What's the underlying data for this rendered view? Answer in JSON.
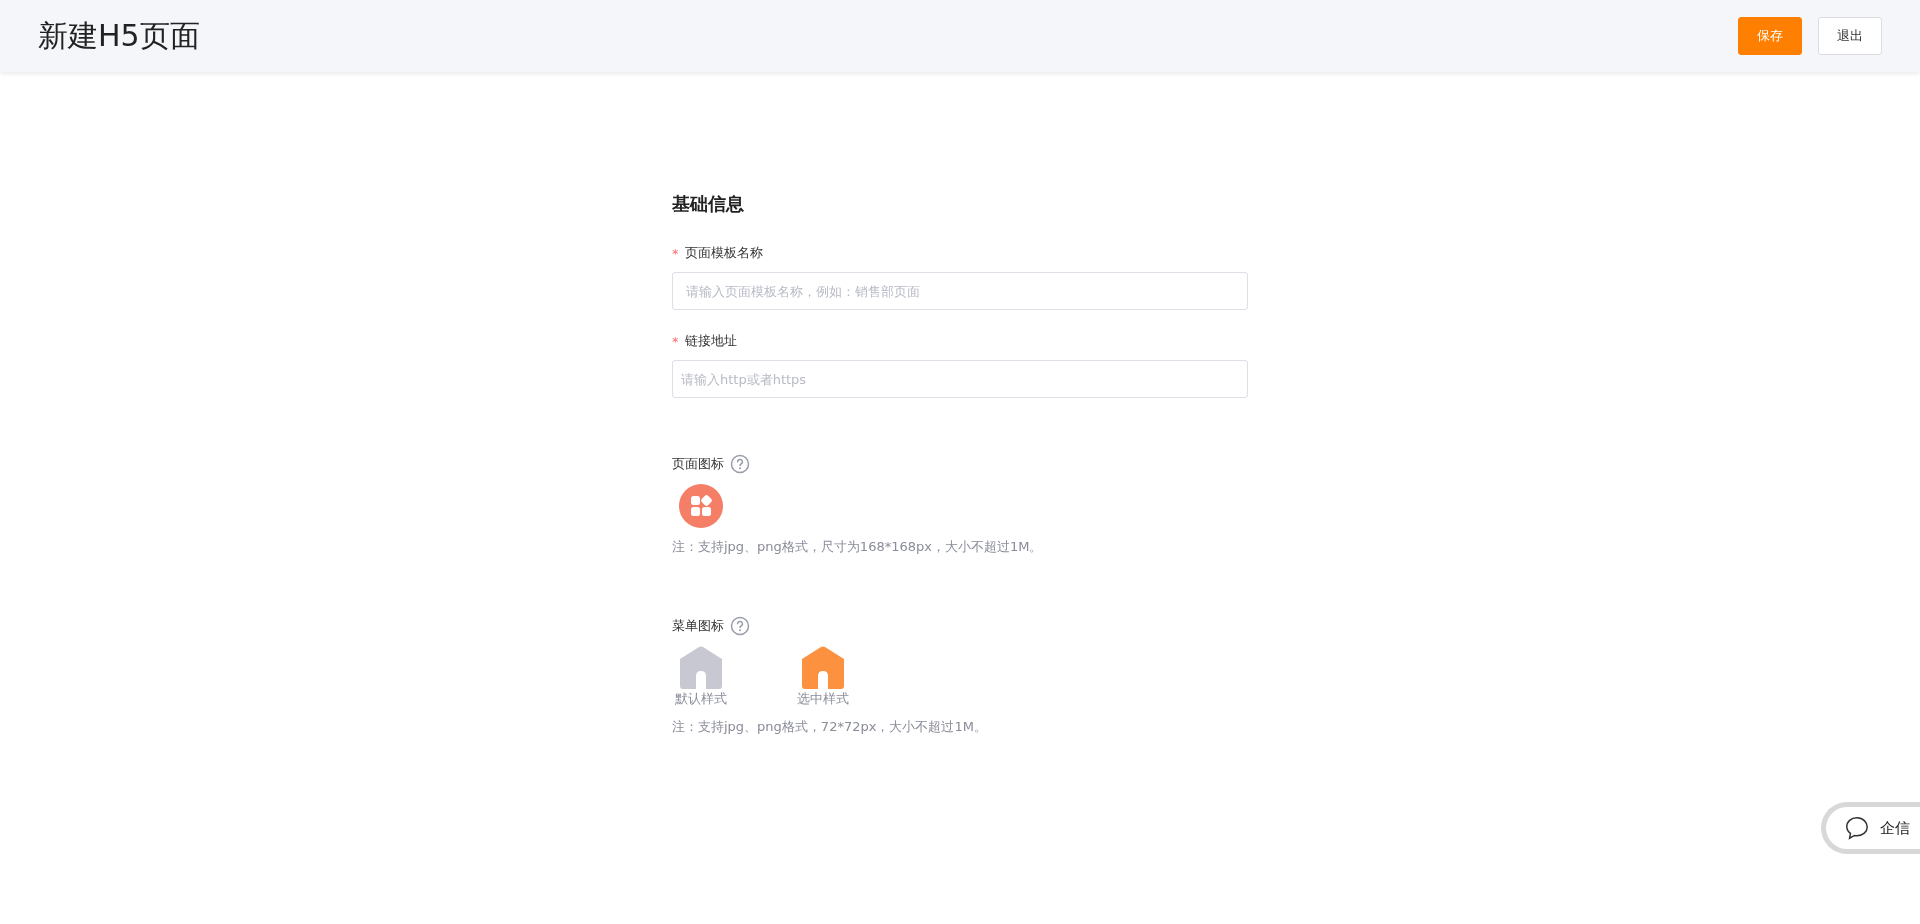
{
  "header": {
    "title": "新建H5页面",
    "buttons": [
      {
        "label": "保存",
        "kind": "primary"
      },
      {
        "label": "退出",
        "kind": "default"
      }
    ]
  },
  "form": {
    "heading": "基础信息",
    "fields": [
      {
        "label": "页面模板名称",
        "required_mark": "*",
        "placeholder": "请输入页面模板名称，例如：销售部页面"
      },
      {
        "label": "链接地址",
        "required_mark": "*",
        "placeholder": "请输入http或者https"
      }
    ],
    "page_icon": {
      "label": "页面图标",
      "note": "注：支持jpg、png格式，尺寸为168*168px，大小不超过1M。"
    },
    "menu_icon": {
      "label": "菜单图标",
      "styles": [
        {
          "caption": "默认样式",
          "color": "#c8c8d2"
        },
        {
          "caption": "选中样式",
          "color": "#fc9240"
        }
      ],
      "note": "注：支持jpg、png格式，72*72px，大小不超过1M。"
    }
  },
  "chat_widget": {
    "label": "企信"
  }
}
